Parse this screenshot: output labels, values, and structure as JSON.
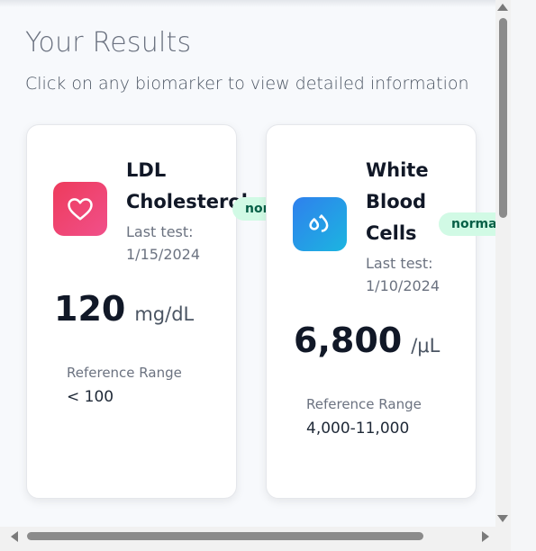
{
  "header": {
    "title": "Your Results",
    "subtitle": "Click on any biomarker to view detailed information"
  },
  "cards": [
    {
      "name": "LDL\nCholesterol",
      "icon": "heart-icon",
      "last_test_label": "Last test:",
      "last_test_date": "1/15/2024",
      "status": "normal",
      "value": "120",
      "unit": "mg/dL",
      "reference_label": "Reference Range",
      "reference_value": "< 100",
      "accent": "#ee3b5c"
    },
    {
      "name": "White\nBlood\nCells",
      "icon": "water-drops-icon",
      "last_test_label": "Last test:",
      "last_test_date": "1/10/2024",
      "status": "normal",
      "value": "6,800",
      "unit": "/μL",
      "reference_label": "Reference Range",
      "reference_value": "4,000-11,000",
      "accent": "#2f80ed"
    }
  ],
  "colors": {
    "badge_bg": "#d1fae5",
    "badge_text": "#065f46"
  }
}
